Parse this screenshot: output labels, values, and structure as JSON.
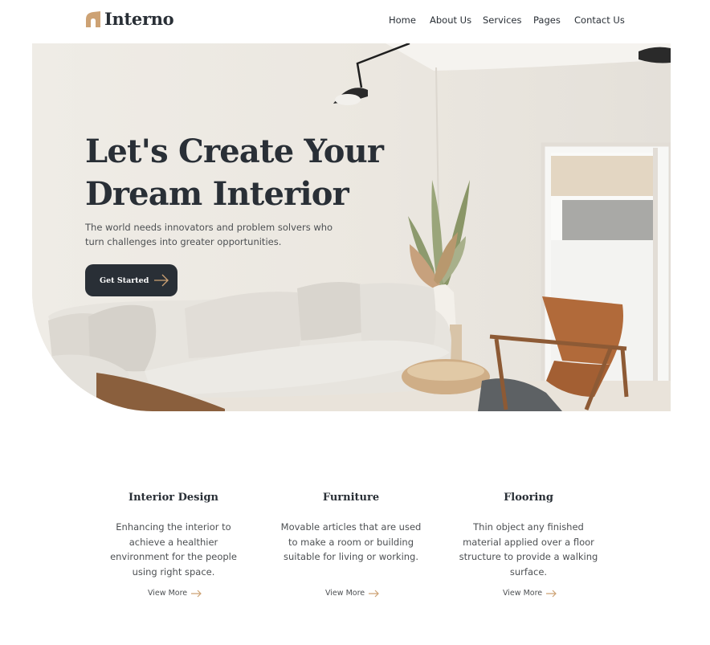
{
  "brand": {
    "name": "Interno",
    "accent_color": "#cda274",
    "dark_color": "#292f36"
  },
  "nav": {
    "items": [
      {
        "label": "Home"
      },
      {
        "label": "About Us"
      },
      {
        "label": "Services"
      },
      {
        "label": "Pages"
      },
      {
        "label": "Contact Us"
      }
    ]
  },
  "hero": {
    "title_line1": "Let's Create Your",
    "title_line2": "Dream Interior",
    "subtitle": "The world needs innovators and problem solvers who turn challenges into greater opportunities.",
    "cta_label": "Get Started",
    "cta_icon": "arrow-right-icon"
  },
  "services": [
    {
      "title": "Interior Design",
      "description": "Enhancing the interior to achieve a healthier environment for the people using right space.",
      "link_label": "View More"
    },
    {
      "title": "Furniture",
      "description": "Movable articles that are used to make a room or building suitable for living or working.",
      "link_label": "View More"
    },
    {
      "title": "Flooring",
      "description": "Thin object any finished material applied over a floor structure to provide a walking surface.",
      "link_label": "View More"
    }
  ]
}
